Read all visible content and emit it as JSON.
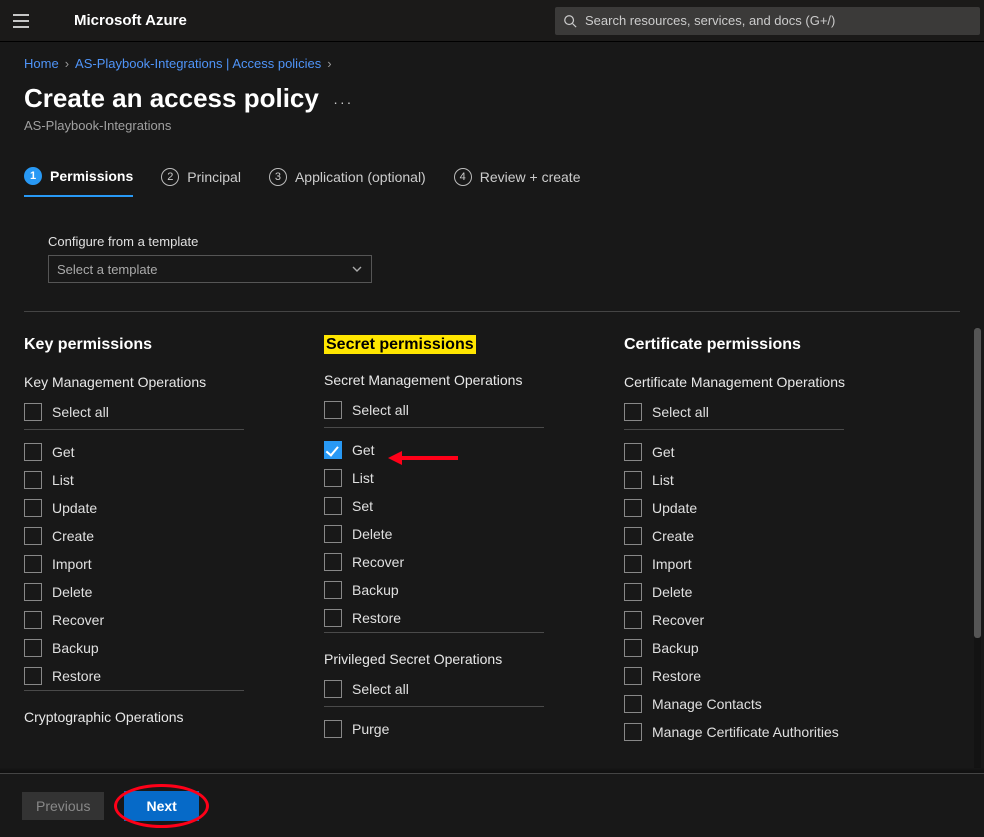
{
  "brand": "Microsoft Azure",
  "search_placeholder": "Search resources, services, and docs (G+/)",
  "breadcrumbs": {
    "home": "Home",
    "parent": "AS-Playbook-Integrations | Access policies"
  },
  "page_title": "Create an access policy",
  "subtitle": "AS-Playbook-Integrations",
  "steps": {
    "s1": "Permissions",
    "s2": "Principal",
    "s3": "Application (optional)",
    "s4": "Review + create"
  },
  "template": {
    "label": "Configure from a template",
    "placeholder": "Select a template"
  },
  "select_all": "Select all",
  "key": {
    "title": "Key permissions",
    "mgmt_head": "Key Management Operations",
    "ops": {
      "get": "Get",
      "list": "List",
      "update": "Update",
      "create": "Create",
      "import": "Import",
      "delete": "Delete",
      "recover": "Recover",
      "backup": "Backup",
      "restore": "Restore"
    },
    "crypto_head": "Cryptographic Operations"
  },
  "secret": {
    "title": "Secret permissions",
    "mgmt_head": "Secret Management Operations",
    "ops": {
      "get": "Get",
      "list": "List",
      "set": "Set",
      "delete": "Delete",
      "recover": "Recover",
      "backup": "Backup",
      "restore": "Restore"
    },
    "priv_head": "Privileged Secret Operations",
    "priv_ops": {
      "purge": "Purge"
    }
  },
  "cert": {
    "title": "Certificate permissions",
    "mgmt_head": "Certificate Management Operations",
    "ops": {
      "get": "Get",
      "list": "List",
      "update": "Update",
      "create": "Create",
      "import": "Import",
      "delete": "Delete",
      "recover": "Recover",
      "backup": "Backup",
      "restore": "Restore",
      "mc": "Manage Contacts",
      "mca": "Manage Certificate Authorities"
    }
  },
  "footer": {
    "previous": "Previous",
    "next": "Next"
  }
}
